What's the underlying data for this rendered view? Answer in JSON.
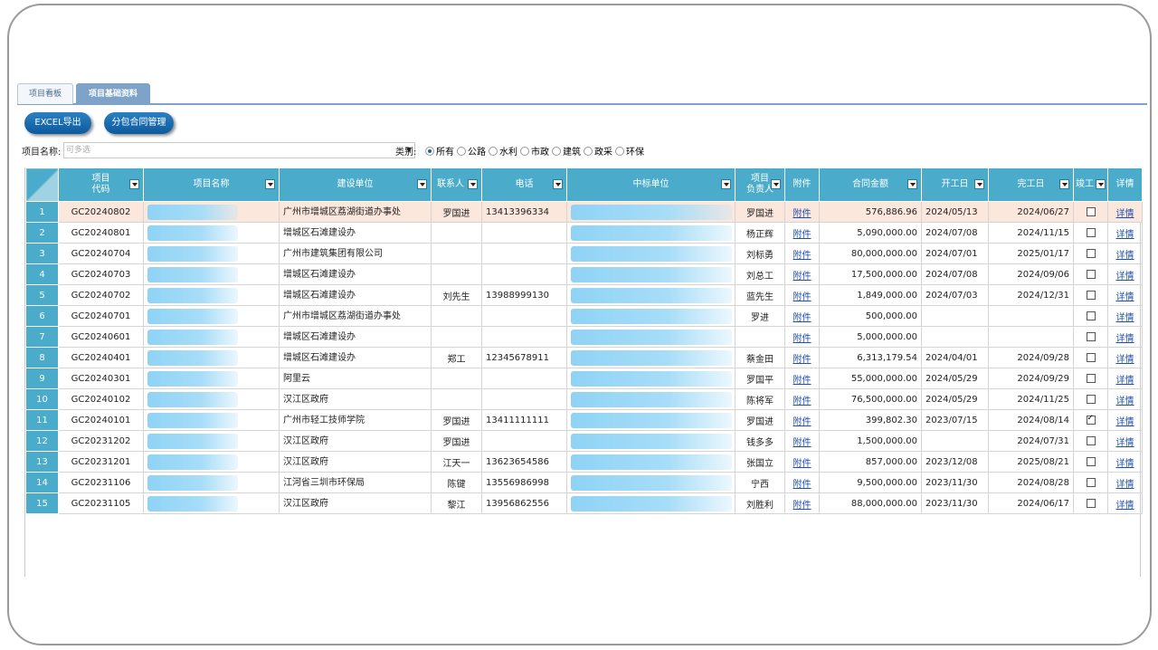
{
  "tabs": [
    {
      "label": "项目看板",
      "active": false
    },
    {
      "label": "项目基础资料",
      "active": true
    }
  ],
  "toolbar": {
    "excel_label": "EXCEL导出",
    "sub_label": "分包合同管理"
  },
  "filter": {
    "name_label": "项目名称:",
    "name_placeholder": "可多选",
    "category_label": "类别:",
    "categories": [
      "所有",
      "公路",
      "水利",
      "市政",
      "建筑",
      "政采",
      "环保"
    ],
    "selected_category": "所有"
  },
  "columns": {
    "code": "项目\n代码",
    "name": "项目名称",
    "builder": "建设单位",
    "contact": "联系人",
    "phone": "电话",
    "winner": "中标单位",
    "manager": "项目\n负责人",
    "attachment": "附件",
    "amount": "合同金额",
    "start": "开工日",
    "finish": "完工日",
    "done": "竣工",
    "detail": "详情"
  },
  "accent_color": "#4aacca",
  "rows": [
    {
      "no": "1",
      "code": "GC20240802",
      "builder": "广州市增城区荔湖街道办事处",
      "contact": "罗国进",
      "phone": "13413396334",
      "manager": "罗国进",
      "attachment": "附件",
      "amount": "576,886.96",
      "start": "2024/05/13",
      "finish": "2024/06/27",
      "done": false,
      "detail": "详情"
    },
    {
      "no": "2",
      "code": "GC20240801",
      "builder": "增城区石滩建设办",
      "contact": "",
      "phone": "",
      "manager": "杨正辉",
      "attachment": "附件",
      "amount": "5,090,000.00",
      "start": "2024/07/08",
      "finish": "2024/11/15",
      "done": false,
      "detail": "详情"
    },
    {
      "no": "3",
      "code": "GC20240704",
      "builder": "广州市建筑集团有限公司",
      "contact": "",
      "phone": "",
      "manager": "刘标勇",
      "attachment": "附件",
      "amount": "80,000,000.00",
      "start": "2024/07/01",
      "finish": "2025/01/17",
      "done": false,
      "detail": "详情"
    },
    {
      "no": "4",
      "code": "GC20240703",
      "builder": "增城区石滩建设办",
      "contact": "",
      "phone": "",
      "manager": "刘总工",
      "attachment": "附件",
      "amount": "17,500,000.00",
      "start": "2024/07/08",
      "finish": "2024/09/06",
      "done": false,
      "detail": "详情"
    },
    {
      "no": "5",
      "code": "GC20240702",
      "builder": "增城区石滩建设办",
      "contact": "刘先生",
      "phone": "13988999130",
      "manager": "蓝先生",
      "attachment": "附件",
      "amount": "1,849,000.00",
      "start": "2024/07/03",
      "finish": "2024/12/31",
      "done": false,
      "detail": "详情"
    },
    {
      "no": "6",
      "code": "GC20240701",
      "builder": "广州市增城区荔湖街道办事处",
      "contact": "",
      "phone": "",
      "manager": "罗进",
      "attachment": "附件",
      "amount": "500,000.00",
      "start": "",
      "finish": "",
      "done": false,
      "detail": "详情"
    },
    {
      "no": "7",
      "code": "GC20240601",
      "builder": "增城区石滩建设办",
      "contact": "",
      "phone": "",
      "manager": "",
      "attachment": "附件",
      "amount": "5,000,000.00",
      "start": "",
      "finish": "",
      "done": false,
      "detail": "详情"
    },
    {
      "no": "8",
      "code": "GC20240401",
      "builder": "增城区石滩建设办",
      "contact": "郑工",
      "phone": "12345678911",
      "manager": "蔡金田",
      "attachment": "附件",
      "amount": "6,313,179.54",
      "start": "2024/04/01",
      "finish": "2024/09/28",
      "done": false,
      "detail": "详情"
    },
    {
      "no": "9",
      "code": "GC20240301",
      "builder": "阿里云",
      "contact": "",
      "phone": "",
      "manager": "罗国平",
      "attachment": "附件",
      "amount": "55,000,000.00",
      "start": "2024/05/29",
      "finish": "2024/09/29",
      "done": false,
      "detail": "详情"
    },
    {
      "no": "10",
      "code": "GC20240102",
      "builder": "汉江区政府",
      "contact": "",
      "phone": "",
      "manager": "陈将军",
      "attachment": "附件",
      "amount": "76,500,000.00",
      "start": "2024/05/29",
      "finish": "2024/11/25",
      "done": false,
      "detail": "详情"
    },
    {
      "no": "11",
      "code": "GC20240101",
      "builder": "广州市轻工技师学院",
      "contact": "罗国进",
      "phone": "13411111111",
      "manager": "罗国进",
      "attachment": "附件",
      "amount": "399,802.30",
      "start": "2023/07/15",
      "finish": "2024/08/14",
      "done": true,
      "detail": "详情"
    },
    {
      "no": "12",
      "code": "GC20231202",
      "builder": "汉江区政府",
      "contact": "罗国进",
      "phone": "",
      "manager": "钱多多",
      "attachment": "附件",
      "amount": "1,500,000.00",
      "start": "",
      "finish": "2024/07/31",
      "done": false,
      "detail": "详情"
    },
    {
      "no": "13",
      "code": "GC20231201",
      "builder": "汉江区政府",
      "contact": "江天一",
      "phone": "13623654586",
      "manager": "张国立",
      "attachment": "附件",
      "amount": "857,000.00",
      "start": "2023/12/08",
      "finish": "2025/08/21",
      "done": false,
      "detail": "详情"
    },
    {
      "no": "14",
      "code": "GC20231106",
      "builder": "江河省三圳市环保局",
      "contact": "陈键",
      "phone": "13556986998",
      "manager": "宁西",
      "attachment": "附件",
      "amount": "9,500,000.00",
      "start": "2023/11/30",
      "finish": "2024/08/28",
      "done": false,
      "detail": "详情"
    },
    {
      "no": "15",
      "code": "GC20231105",
      "builder": "汉江区政府",
      "contact": "黎江",
      "phone": "13956862556",
      "manager": "刘胜利",
      "attachment": "附件",
      "amount": "88,000,000.00",
      "start": "2023/11/30",
      "finish": "2024/06/17",
      "done": false,
      "detail": "详情"
    }
  ]
}
